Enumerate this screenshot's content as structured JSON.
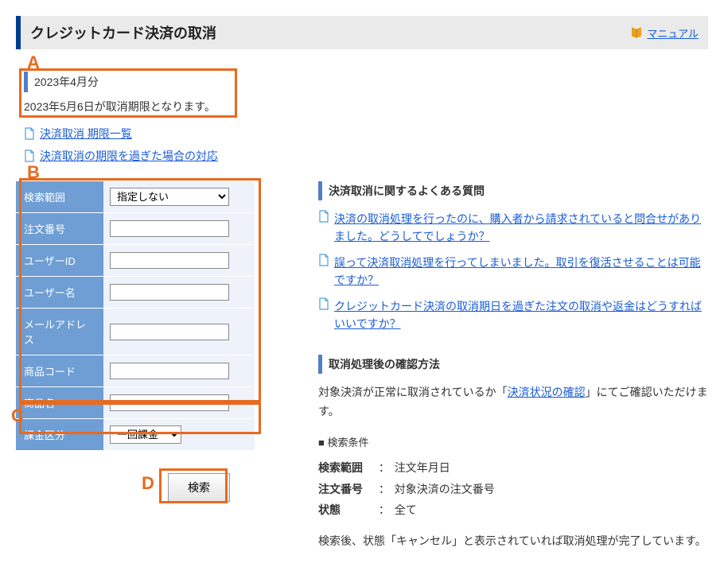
{
  "header": {
    "title": "クレジットカード決済の取消",
    "manual": "マニュアル"
  },
  "annotations": {
    "a": "A",
    "b": "B",
    "c": "C",
    "d": "D"
  },
  "sectionA": {
    "periodHeading": "2023年4月分",
    "deadlineText": "2023年5月6日が取消期限となります。"
  },
  "docLinks": [
    "決済取消 期限一覧",
    "決済取消の期限を過ぎた場合の対応"
  ],
  "searchForm": {
    "rows": [
      {
        "label": "検索範囲",
        "type": "select",
        "value": "指定しない"
      },
      {
        "label": "注文番号",
        "type": "text",
        "value": ""
      },
      {
        "label": "ユーザーID",
        "type": "text",
        "value": ""
      },
      {
        "label": "ユーザー名",
        "type": "text",
        "value": ""
      },
      {
        "label": "メールアドレス",
        "type": "text",
        "value": ""
      },
      {
        "label": "商品コード",
        "type": "text",
        "value": ""
      },
      {
        "label": "商品名",
        "type": "text",
        "value": ""
      }
    ],
    "billingRow": {
      "label": "課金区分",
      "value": "一回課金"
    },
    "searchButton": "検索"
  },
  "faqSection": {
    "heading": "決済取消に関するよくある質問",
    "items": [
      "決済の取消処理を行ったのに、購入者から請求されていると問合せがありました。どうしてでしょうか？",
      "誤って決済取消処理を行ってしまいました。取引を復活させることは可能ですか？",
      "クレジットカード決済の取消期日を過ぎた注文の取消や返金はどうすればいいですか？"
    ]
  },
  "confirmSection": {
    "heading": "取消処理後の確認方法",
    "textPre": "対象決済が正常に取消されているか「",
    "linkText": "決済状況の確認",
    "textPost": "」にてご確認いただけます。",
    "condTitle": "検索条件",
    "conditions": [
      {
        "label": "検索範囲",
        "value": "注文年月日"
      },
      {
        "label": "注文番号",
        "value": "対象決済の注文番号"
      },
      {
        "label": "状態",
        "value": "全て"
      }
    ],
    "note": "検索後、状態「キャンセル」と表示されていれば取消処理が完了しています。"
  }
}
